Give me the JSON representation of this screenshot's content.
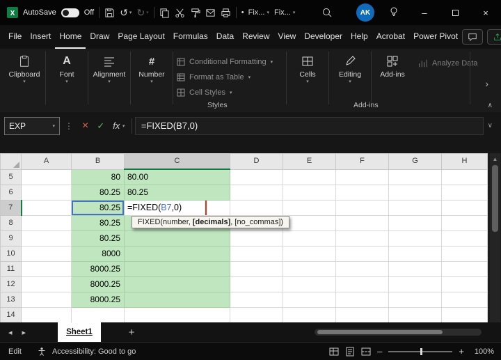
{
  "title_bar": {
    "autosave_label": "AutoSave",
    "autosave_state": "Off",
    "fix_dropdown_1": "Fix...",
    "fix_dropdown_2": "Fix...",
    "avatar_initials": "AK"
  },
  "menu": {
    "items": [
      "File",
      "Insert",
      "Home",
      "Draw",
      "Page Layout",
      "Formulas",
      "Data",
      "Review",
      "View",
      "Developer",
      "Help",
      "Acrobat",
      "Power Pivot"
    ],
    "active_item": "Home"
  },
  "ribbon": {
    "clipboard_label": "Clipboard",
    "font_label": "Font",
    "alignment_label": "Alignment",
    "number_label": "Number",
    "styles_items": [
      "Conditional Formatting",
      "Format as Table",
      "Cell Styles"
    ],
    "styles_group_label": "Styles",
    "cells_label": "Cells",
    "editing_label": "Editing",
    "addins_button_label": "Add-ins",
    "addins_group_label": "Add-ins",
    "analyze_data_label": "Analyze Data"
  },
  "formula_bar": {
    "name_box_value": "EXP",
    "formula": "=FIXED(B7,0)"
  },
  "grid": {
    "col_headers": [
      "A",
      "B",
      "C",
      "D",
      "E",
      "F",
      "G",
      "H"
    ],
    "row_headers": [
      "5",
      "6",
      "7",
      "8",
      "9",
      "10",
      "11",
      "12",
      "13",
      "14"
    ],
    "b_values": [
      "80",
      "80.25",
      "80.25",
      "80.25",
      "80.25",
      "8000",
      "8000.25",
      "8000.25",
      "8000.25"
    ],
    "c_values": [
      "80.00",
      "80.25"
    ],
    "edit": {
      "prefix": "=FIXED(",
      "ref": "B7",
      "suffix": ",0)"
    },
    "tooltip": {
      "pre": "FIXED(number, ",
      "bold": "[decimals]",
      "post": ", [no_commas])"
    }
  },
  "sheet_bar": {
    "active_tab": "Sheet1"
  },
  "status_bar": {
    "mode": "Edit",
    "accessibility_status": "Accessibility: Good to go",
    "zoom_level": "100%"
  },
  "colors": {
    "excel_green": "#107C41",
    "cell_fill_green": "#C0E6C0",
    "reference_blue": "#4472C4",
    "annotation_red": "#E02B1D",
    "avatar_blue": "#0F6CBD"
  }
}
